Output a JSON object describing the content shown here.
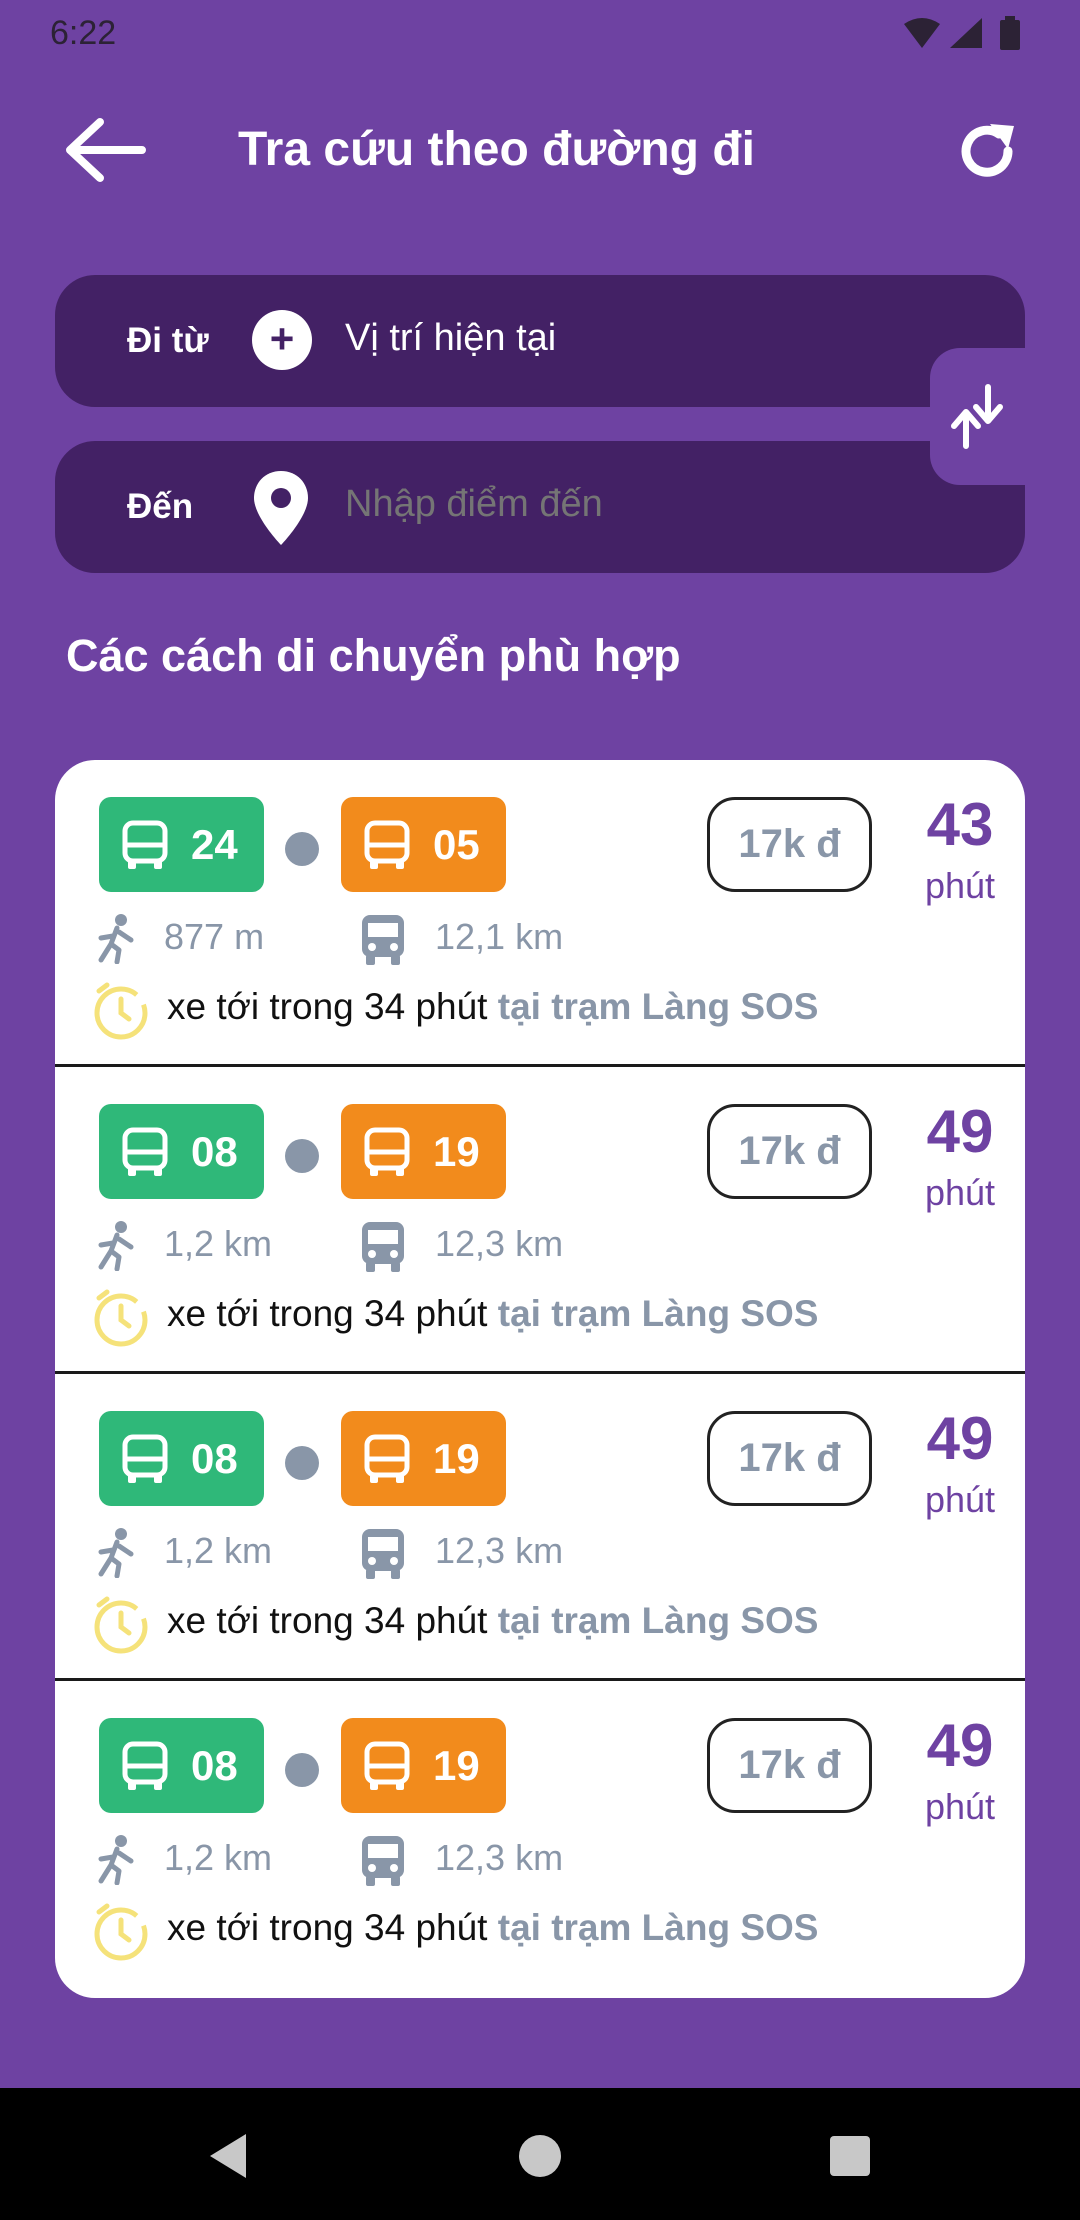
{
  "status": {
    "time": "6:22"
  },
  "header": {
    "title": "Tra cứu theo đường đi"
  },
  "search": {
    "from_label": "Đi từ",
    "from_value": "Vị trí hiện tại",
    "to_label": "Đến",
    "to_placeholder": "Nhập điểm đến"
  },
  "section_title": "Các cách di chuyển phù hợp",
  "colors": {
    "background": "#6e42a2",
    "field": "#432165",
    "green": "#2fb879",
    "orange": "#f28b1c",
    "muted": "#8996a8"
  },
  "results": [
    {
      "route_a": "24",
      "route_b": "05",
      "price": "17k đ",
      "duration": "43",
      "duration_unit": "phút",
      "walk": "877 m",
      "bus": "12,1 km",
      "arrival": "xe tới trong 34 phút",
      "stop": "tại trạm Làng SOS"
    },
    {
      "route_a": "08",
      "route_b": "19",
      "price": "17k đ",
      "duration": "49",
      "duration_unit": "phút",
      "walk": "1,2 km",
      "bus": "12,3 km",
      "arrival": "xe tới trong 34 phút",
      "stop": "tại trạm Làng SOS"
    },
    {
      "route_a": "08",
      "route_b": "19",
      "price": "17k đ",
      "duration": "49",
      "duration_unit": "phút",
      "walk": "1,2 km",
      "bus": "12,3 km",
      "arrival": "xe tới trong 34 phút",
      "stop": "tại trạm Làng SOS"
    },
    {
      "route_a": "08",
      "route_b": "19",
      "price": "17k đ",
      "duration": "49",
      "duration_unit": "phút",
      "walk": "1,2 km",
      "bus": "12,3 km",
      "arrival": "xe tới trong 34 phút",
      "stop": "tại trạm Làng SOS"
    }
  ]
}
